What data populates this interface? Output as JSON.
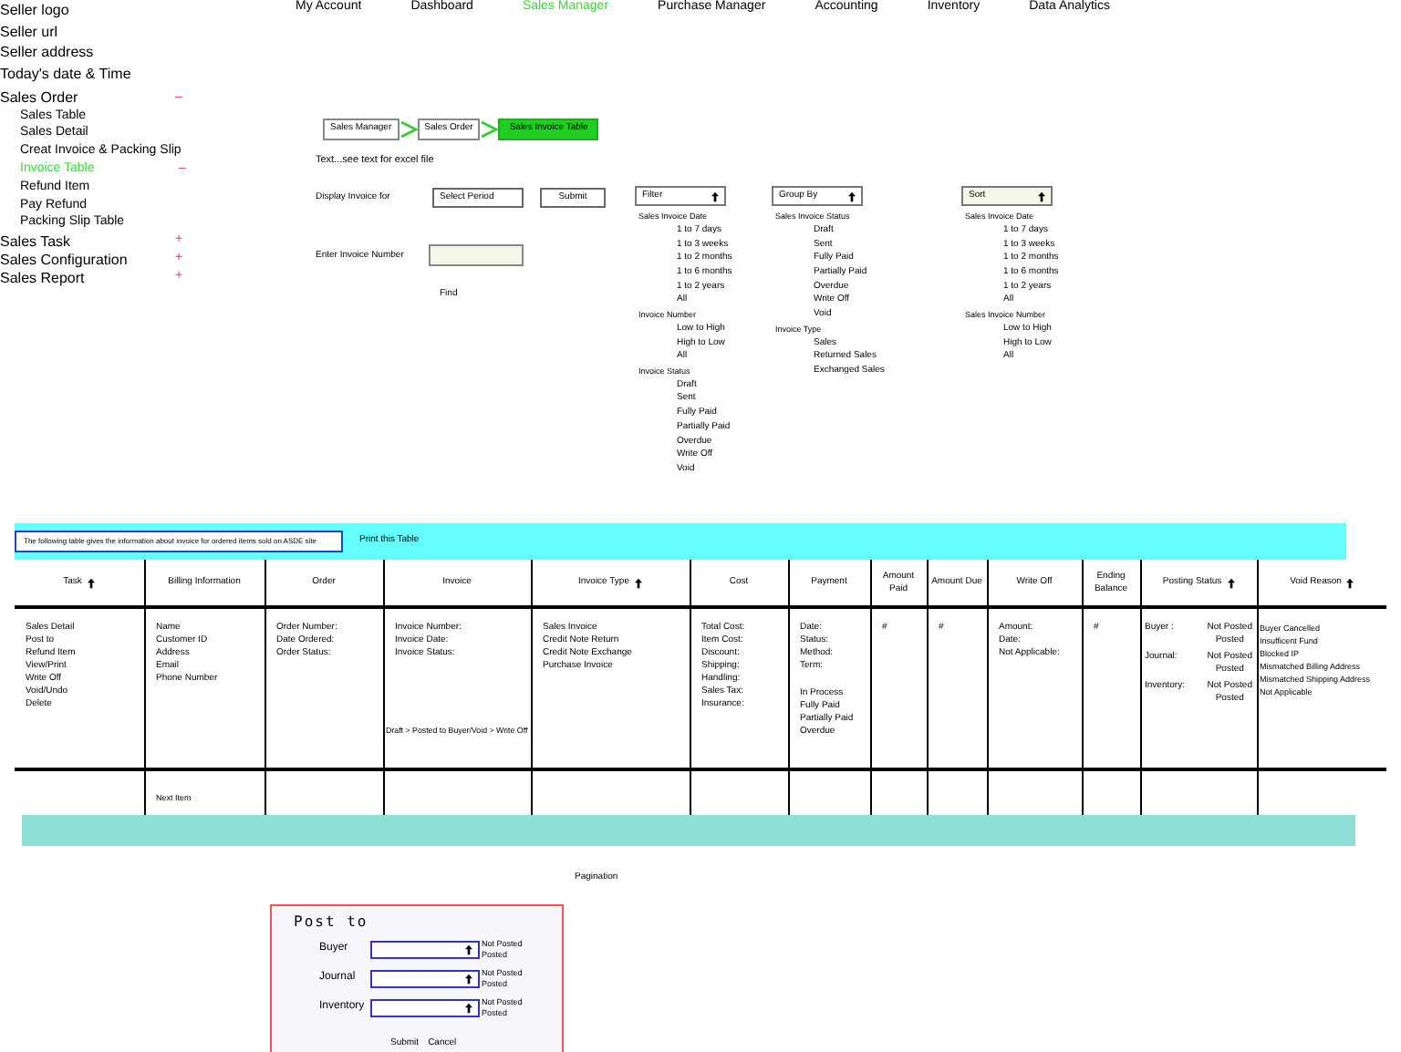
{
  "seller_info": [
    "Seller logo",
    "Seller url",
    "Seller address",
    "Today's date & Time"
  ],
  "sidebar": {
    "sections": [
      {
        "label": "Sales Order",
        "marker": "–",
        "expanded": true,
        "children": [
          {
            "label": "Sales Table",
            "selected": false
          },
          {
            "label": "Sales Detail",
            "selected": false
          },
          {
            "label": "Creat Invoice & Packing Slip",
            "selected": false
          },
          {
            "label": "Invoice Table",
            "selected": true,
            "marker": "–"
          },
          {
            "label": "Refund Item",
            "selected": false
          },
          {
            "label": "Pay Refund",
            "selected": false
          },
          {
            "label": "Packing Slip Table",
            "selected": false
          }
        ]
      },
      {
        "label": "Sales Task",
        "marker": "+",
        "expanded": false
      },
      {
        "label": "Sales Configuration",
        "marker": "+",
        "expanded": false
      },
      {
        "label": "Sales Report",
        "marker": "+",
        "expanded": false
      }
    ]
  },
  "nav": [
    {
      "label": "My Account",
      "selected": false
    },
    {
      "label": "Dashboard",
      "selected": false
    },
    {
      "label": "Sales Manager",
      "selected": true
    },
    {
      "label": "Purchase Manager",
      "selected": false
    },
    {
      "label": "Accounting",
      "selected": false
    },
    {
      "label": "Inventory",
      "selected": false
    },
    {
      "label": "Data Analytics",
      "selected": false
    }
  ],
  "breadcrumb": [
    {
      "label": "Sales Manager",
      "selected": false
    },
    {
      "label": "Sales Order",
      "selected": false
    },
    {
      "label": "Sales Invoice Table",
      "selected": true
    }
  ],
  "note": "Text...see text for excel file",
  "display": {
    "label": "Display Invoice for",
    "period_select": "Select Period",
    "submit": "Submit"
  },
  "invoice_search": {
    "label": "Enter Invoice Number",
    "find": "Find"
  },
  "dropdowns": [
    {
      "label": "Filter",
      "groups": [
        {
          "heading": "Sales Invoice Date",
          "options": [
            "1 to 7 days",
            "1 to 3 weeks",
            "1 to 2 months",
            "1 to 6 months",
            "1 to 2 years",
            "All"
          ]
        },
        {
          "heading": "Invoice Number",
          "options": [
            "Low to High",
            "High to Low",
            "All"
          ]
        },
        {
          "heading": "Invoice Status",
          "options": [
            "Draft",
            "Sent",
            "Fully Paid",
            "Partially Paid",
            "Overdue",
            "Write Off",
            "Void"
          ]
        }
      ]
    },
    {
      "label": "Group By",
      "groups": [
        {
          "heading": "Sales Invoice Status",
          "options": [
            "Draft",
            "Sent",
            "Fully Paid",
            "Partially Paid",
            "Overdue",
            "Write Off",
            "Void"
          ]
        },
        {
          "heading": "Invoice Type",
          "options": [
            "Sales",
            "Returned Sales",
            "Exchanged Sales"
          ]
        }
      ]
    },
    {
      "label": "Sort",
      "groups": [
        {
          "heading": "Sales Invoice Date",
          "options": [
            "1 to 7 days",
            "1 to 3 weeks",
            "1 to 2 months",
            "1 to 6 months",
            "1 to 2 years",
            "All"
          ]
        },
        {
          "heading": "Sales Invoice Number",
          "options": [
            "Low to High",
            "High to Low",
            "All"
          ]
        }
      ]
    }
  ],
  "table": {
    "caption": "The following table gives the information about invoice for ordered items sold on ASDE site",
    "print_link": "Print this Table",
    "columns": [
      {
        "label": "Task",
        "sortable": true
      },
      {
        "label": "Billing Information"
      },
      {
        "label": "Order"
      },
      {
        "label": "Invoice"
      },
      {
        "label": "Invoice Type",
        "sortable": true
      },
      {
        "label": "Cost"
      },
      {
        "label": "Payment"
      },
      {
        "label": "Amount Paid"
      },
      {
        "label": "Amount Due"
      },
      {
        "label": "Write Off"
      },
      {
        "label": "Ending Balance"
      },
      {
        "label": "Posting Status",
        "sortable": true
      },
      {
        "label": "Void Reason",
        "sortable": true
      }
    ],
    "row": [
      {
        "kind": "lines",
        "groups": [
          [
            "Sales Detail",
            "Post to",
            "Refund Item",
            "View/Print",
            "Write Off",
            "Void/Undo",
            "Delete"
          ]
        ]
      },
      {
        "kind": "lines",
        "groups": [
          [
            "Name",
            "Customer ID",
            "Address",
            "Email",
            "Phone Number"
          ]
        ]
      },
      {
        "kind": "lines",
        "groups": [
          [
            "Order Number:",
            "Date Ordered:",
            "Order Status:"
          ]
        ]
      },
      {
        "kind": "lines",
        "groups": [
          [
            "Invoice Number:",
            "Invoice Date:",
            "Invoice Status:"
          ]
        ],
        "note": "Draft > Posted to Buyer/Void > Write Off"
      },
      {
        "kind": "lines",
        "groups": [
          [
            "Sales Invoice",
            "Credit Note Return",
            "Credit Note Exchange",
            "Purchase Invoice"
          ]
        ]
      },
      {
        "kind": "lines",
        "groups": [
          [
            "Total Cost:",
            "Item Cost:",
            "Discount:",
            "Shipping:",
            "Handling:",
            "Sales Tax:",
            "Insurance:"
          ]
        ]
      },
      {
        "kind": "lines",
        "groups": [
          [
            "Date:",
            "Status:",
            "Method:",
            "Term:"
          ],
          [
            "In Process",
            "Fully Paid",
            "Partially Paid",
            "Overdue"
          ]
        ]
      },
      {
        "kind": "lines",
        "groups": [
          [
            "#"
          ]
        ]
      },
      {
        "kind": "lines",
        "groups": [
          [
            "#"
          ]
        ]
      },
      {
        "kind": "lines",
        "groups": [
          [
            "Amount:",
            "Date:",
            "Not Applicable:"
          ]
        ]
      },
      {
        "kind": "lines",
        "groups": [
          [
            "#"
          ]
        ]
      },
      {
        "kind": "pairs",
        "pairs": [
          {
            "label": "Buyer :",
            "values": [
              "Not Posted",
              "Posted"
            ]
          },
          {
            "label": "Journal:",
            "values": [
              "Not Posted",
              "Posted"
            ]
          },
          {
            "label": "Inventory:",
            "values": [
              "Not Posted",
              "Posted"
            ]
          }
        ]
      },
      {
        "kind": "lines",
        "groups": [
          [
            "Buyer Cancelled",
            "Insufficent Fund",
            "Blocked IP",
            "Mismatched Billing Address",
            "Mismatched Shipping Address",
            "Not Applicable"
          ]
        ]
      }
    ],
    "next_row_label": "Next Item"
  },
  "pagination": "Pagination",
  "post_dialog": {
    "title": "Post to",
    "rows": [
      {
        "label": "Buyer",
        "options": [
          "Not Posted",
          "Posted"
        ]
      },
      {
        "label": "Journal",
        "options": [
          "Not Posted",
          "Posted"
        ]
      },
      {
        "label": "Inventory",
        "options": [
          "Not Posted",
          "Posted"
        ]
      }
    ],
    "actions": [
      "Submit",
      "Cancel"
    ]
  }
}
